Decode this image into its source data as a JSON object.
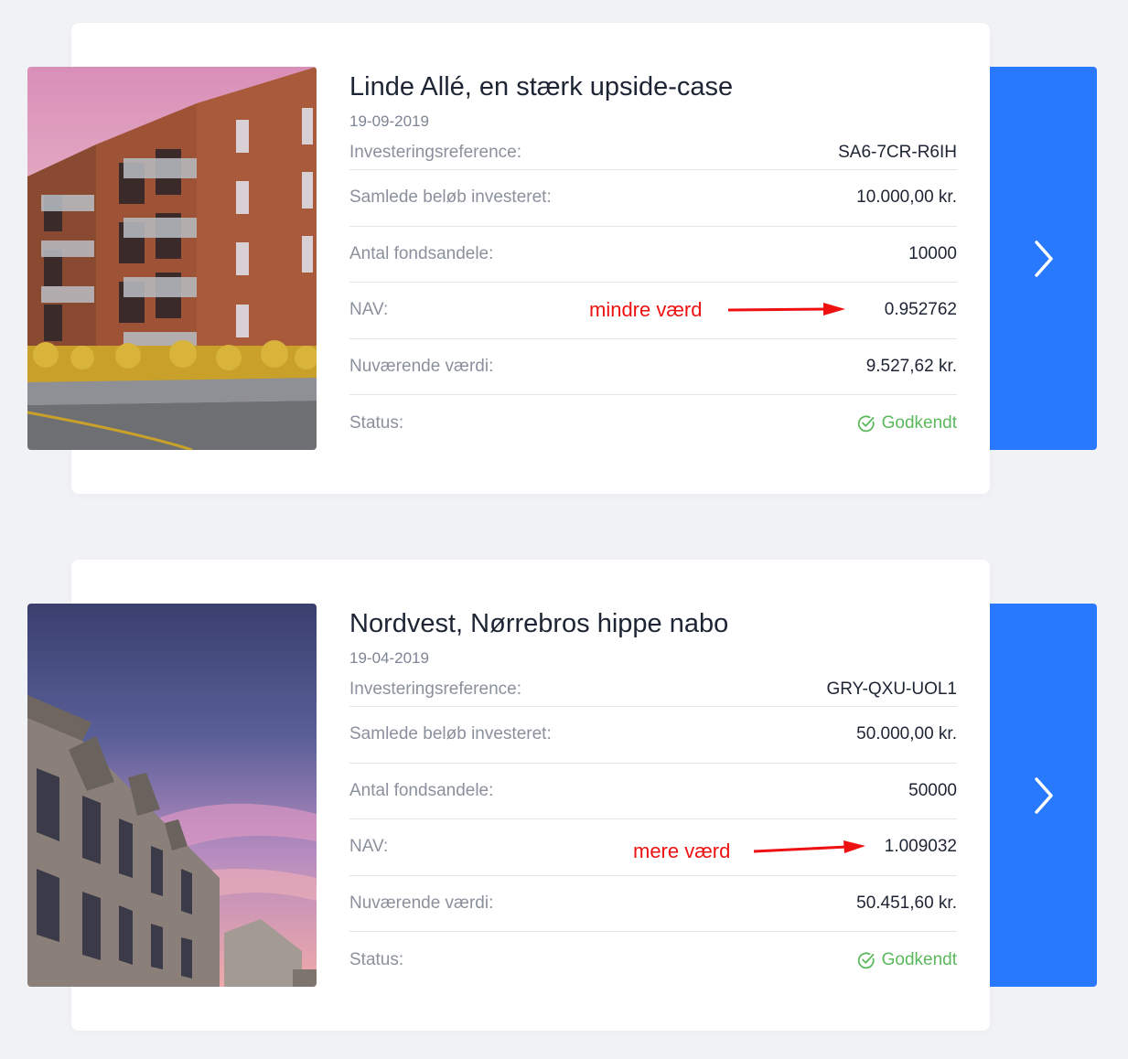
{
  "investments": [
    {
      "title": "Linde Allé, en stærk upside-case",
      "date": "19-09-2019",
      "rows": {
        "reference": {
          "label": "Investeringsreference:",
          "value": "SA6-7CR-R6IH"
        },
        "total": {
          "label": "Samlede beløb investeret:",
          "value": "10.000,00 kr."
        },
        "shares": {
          "label": "Antal fondsandele:",
          "value": "10000"
        },
        "nav": {
          "label": "NAV:",
          "value": "0.952762"
        },
        "current": {
          "label": "Nuværende værdi:",
          "value": "9.527,62 kr."
        },
        "status": {
          "label": "Status:",
          "value": "Godkendt"
        }
      },
      "annotation": "mindre værd"
    },
    {
      "title": "Nordvest, Nørrebros hippe nabo",
      "date": "19-04-2019",
      "rows": {
        "reference": {
          "label": "Investeringsreference:",
          "value": "GRY-QXU-UOL1"
        },
        "total": {
          "label": "Samlede beløb investeret:",
          "value": "50.000,00 kr."
        },
        "shares": {
          "label": "Antal fondsandele:",
          "value": "50000"
        },
        "nav": {
          "label": "NAV:",
          "value": "1.009032"
        },
        "current": {
          "label": "Nuværende værdi:",
          "value": "50.451,60 kr."
        },
        "status": {
          "label": "Status:",
          "value": "Godkendt"
        }
      },
      "annotation": "mere værd"
    }
  ],
  "icons": {
    "status": "check-circle-icon",
    "go": "chevron-right-icon"
  },
  "colors": {
    "accent": "#2979ff",
    "status_ok": "#5cb85c",
    "annotation": "#ee1111",
    "background": "#f1f2f5"
  }
}
